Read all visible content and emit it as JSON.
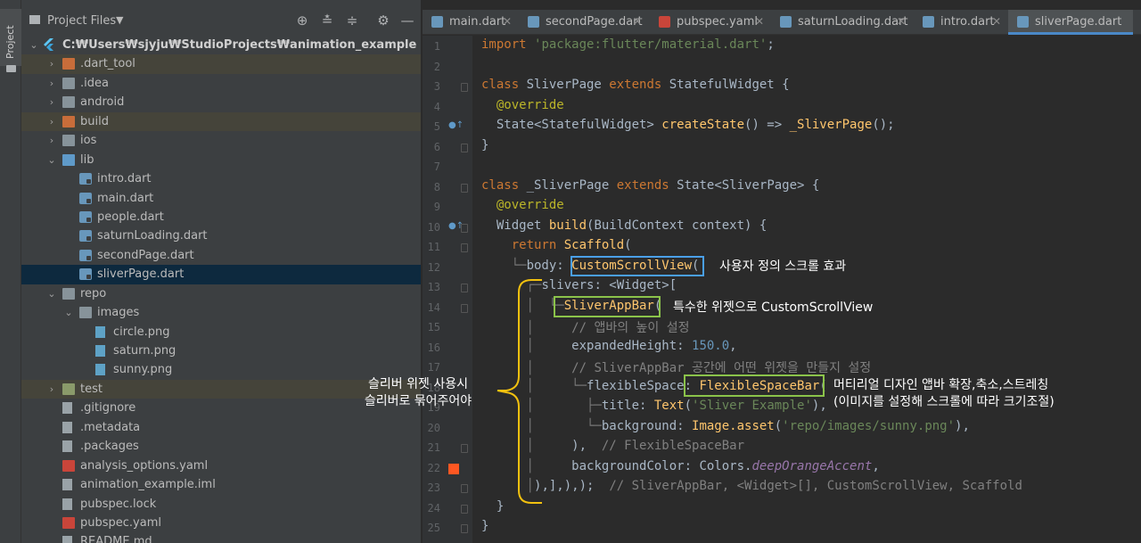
{
  "tool_strip": {
    "project_tab_label": "Project"
  },
  "project_panel": {
    "title": "Project Files",
    "tree": [
      {
        "label": "C:₩Users₩sjyju₩StudioProjects₩animation_example",
        "depth": 0,
        "expanded": true,
        "icon": "flutter-icon",
        "bold": true
      },
      {
        "label": ".dart_tool",
        "depth": 1,
        "expanded": false,
        "icon": "folder-orange-icon",
        "highlight": "yellow"
      },
      {
        "label": ".idea",
        "depth": 1,
        "expanded": false,
        "icon": "folder-icon"
      },
      {
        "label": "android",
        "depth": 1,
        "expanded": false,
        "icon": "folder-icon"
      },
      {
        "label": "build",
        "depth": 1,
        "expanded": false,
        "icon": "folder-orange-icon",
        "highlight": "yellow"
      },
      {
        "label": "ios",
        "depth": 1,
        "expanded": false,
        "icon": "folder-icon"
      },
      {
        "label": "lib",
        "depth": 1,
        "expanded": true,
        "icon": "folder-blue-icon"
      },
      {
        "label": "intro.dart",
        "depth": 2,
        "icon": "dart-file-icon"
      },
      {
        "label": "main.dart",
        "depth": 2,
        "icon": "dart-file-icon"
      },
      {
        "label": "people.dart",
        "depth": 2,
        "icon": "dart-file-icon"
      },
      {
        "label": "saturnLoading.dart",
        "depth": 2,
        "icon": "dart-file-icon"
      },
      {
        "label": "secondPage.dart",
        "depth": 2,
        "icon": "dart-file-icon"
      },
      {
        "label": "sliverPage.dart",
        "depth": 2,
        "icon": "dart-file-icon",
        "highlight": "selected"
      },
      {
        "label": "repo",
        "depth": 1,
        "expanded": true,
        "icon": "folder-icon"
      },
      {
        "label": "images",
        "depth": 2,
        "expanded": true,
        "icon": "folder-icon"
      },
      {
        "label": "circle.png",
        "depth": 3,
        "icon": "png-file-icon"
      },
      {
        "label": "saturn.png",
        "depth": 3,
        "icon": "png-file-icon"
      },
      {
        "label": "sunny.png",
        "depth": 3,
        "icon": "png-file-icon"
      },
      {
        "label": "test",
        "depth": 1,
        "expanded": false,
        "icon": "folder-test-icon",
        "highlight": "yellow"
      },
      {
        "label": ".gitignore",
        "depth": 1,
        "icon": "generic-file-icon"
      },
      {
        "label": ".metadata",
        "depth": 1,
        "icon": "generic-file-icon"
      },
      {
        "label": ".packages",
        "depth": 1,
        "icon": "generic-file-icon"
      },
      {
        "label": "analysis_options.yaml",
        "depth": 1,
        "icon": "yaml-file-icon"
      },
      {
        "label": "animation_example.iml",
        "depth": 1,
        "icon": "generic-file-icon"
      },
      {
        "label": "pubspec.lock",
        "depth": 1,
        "icon": "generic-file-icon"
      },
      {
        "label": "pubspec.yaml",
        "depth": 1,
        "icon": "yaml-file-icon"
      },
      {
        "label": "README.md",
        "depth": 1,
        "icon": "generic-file-icon"
      }
    ]
  },
  "tabs": [
    {
      "label": "main.dart",
      "icon": "dart-file-icon",
      "active": false
    },
    {
      "label": "secondPage.dart",
      "icon": "dart-file-icon",
      "active": false
    },
    {
      "label": "pubspec.yaml",
      "icon": "yaml-file-icon",
      "active": false
    },
    {
      "label": "saturnLoading.dart",
      "icon": "dart-file-icon",
      "active": false
    },
    {
      "label": "intro.dart",
      "icon": "dart-file-icon",
      "active": false
    },
    {
      "label": "sliverPage.dart",
      "icon": "dart-file-icon",
      "active": true
    }
  ],
  "editor": {
    "line_numbers": [
      "1",
      "2",
      "3",
      "4",
      "5",
      "6",
      "7",
      "8",
      "9",
      "10",
      "11",
      "12",
      "13",
      "14",
      "15",
      "16",
      "17",
      "18",
      "19",
      "20",
      "21",
      "22",
      "23",
      "24",
      "25"
    ],
    "lines": [
      [
        [
          "kw",
          "import "
        ],
        [
          "str",
          "'package:flutter/material.dart'"
        ],
        [
          "",
          "; "
        ]
      ],
      [],
      [
        [
          "kw",
          "class "
        ],
        [
          "",
          "SliverPage "
        ],
        [
          "kw",
          "extends "
        ],
        [
          "",
          "StatefulWidget {"
        ]
      ],
      [
        [
          "",
          "  "
        ],
        [
          "ann",
          "@override"
        ]
      ],
      [
        [
          "",
          "  State<StatefulWidget> "
        ],
        [
          "fn",
          "createState"
        ],
        [
          "",
          "() => "
        ],
        [
          "fn",
          "_SliverPage"
        ],
        [
          "",
          "();"
        ]
      ],
      [
        [
          "",
          "}"
        ]
      ],
      [],
      [
        [
          "kw",
          "class "
        ],
        [
          "",
          "_SliverPage "
        ],
        [
          "kw",
          "extends "
        ],
        [
          "",
          "State<SliverPage> {"
        ]
      ],
      [
        [
          "",
          "  "
        ],
        [
          "ann",
          "@override"
        ]
      ],
      [
        [
          "",
          "  Widget "
        ],
        [
          "fn",
          "build"
        ],
        [
          "",
          "(BuildContext context) {"
        ]
      ],
      [
        [
          "",
          "    "
        ],
        [
          "kw",
          "return "
        ],
        [
          "fn",
          "Scaffold"
        ],
        [
          "",
          "("
        ]
      ],
      [
        [
          "guide",
          "    └─"
        ],
        [
          "",
          "body: "
        ],
        [
          "fn",
          "CustomScrollView"
        ],
        [
          "",
          "("
        ]
      ],
      [
        [
          "guide",
          "      ┌─"
        ],
        [
          "",
          "slivers: <Widget>["
        ]
      ],
      [
        [
          "guide",
          "      │  └─"
        ],
        [
          "fn",
          "SliverAppBar"
        ],
        [
          "",
          "("
        ]
      ],
      [
        [
          "guide",
          "      │     "
        ],
        [
          "cm",
          "// 앱바의 높이 설정"
        ]
      ],
      [
        [
          "guide",
          "      │     "
        ],
        [
          "",
          "expandedHeight: "
        ],
        [
          "num",
          "150.0"
        ],
        [
          "",
          ","
        ]
      ],
      [
        [
          "guide",
          "      │     "
        ],
        [
          "cm",
          "// SliverAppBar 공간에 어떤 위젯을 만들지 설정"
        ]
      ],
      [
        [
          "guide",
          "      │     └─"
        ],
        [
          "",
          "flexibleSpace: "
        ],
        [
          "fn",
          "FlexibleSpaceBar"
        ],
        [
          "",
          "("
        ]
      ],
      [
        [
          "guide",
          "      │       ├─"
        ],
        [
          "",
          "title: "
        ],
        [
          "fn",
          "Text"
        ],
        [
          "",
          "("
        ],
        [
          "str",
          "'Sliver Example'"
        ],
        [
          "",
          "),"
        ]
      ],
      [
        [
          "guide",
          "      │       └─"
        ],
        [
          "",
          "background: "
        ],
        [
          "fn",
          "Image.asset"
        ],
        [
          "",
          "("
        ],
        [
          "str",
          "'repo/images/sunny.png'"
        ],
        [
          "",
          "),"
        ]
      ],
      [
        [
          "guide",
          "      │     "
        ],
        [
          "",
          "),  "
        ],
        [
          "cm",
          "// FlexibleSpaceBar"
        ]
      ],
      [
        [
          "guide",
          "      │     "
        ],
        [
          "",
          "backgroundColor: Colors."
        ],
        [
          "prop",
          "deepOrangeAccent"
        ],
        [
          "",
          ","
        ]
      ],
      [
        [
          "guide",
          "      │"
        ],
        [
          "",
          "),],),);  "
        ],
        [
          "cm",
          "// SliverAppBar, <Widget>[], CustomScrollView, Scaffold"
        ]
      ],
      [
        [
          "",
          "  }"
        ]
      ],
      [
        [
          "",
          "}"
        ]
      ]
    ]
  },
  "annotations": {
    "custom_scroll_view_note": "사용자 정의 스크롤 효과",
    "sliver_app_bar_note": "특수한 위젯으로 CustomScrollView",
    "flexible_space_note_line1": "머티리얼 디자인 앱바 확장,축소,스트레칭",
    "flexible_space_note_line2": "(이미지를 설정해 스크롤에 따라 크기조절)",
    "sliver_wrap_note_line1": "슬리버 위젯 사용시",
    "sliver_wrap_note_line2": "슬리버로 묶어주어야",
    "box_color_blue": "#4a9fe8",
    "box_color_green": "#8bc34a",
    "bracket_color": "#f2c10f"
  }
}
